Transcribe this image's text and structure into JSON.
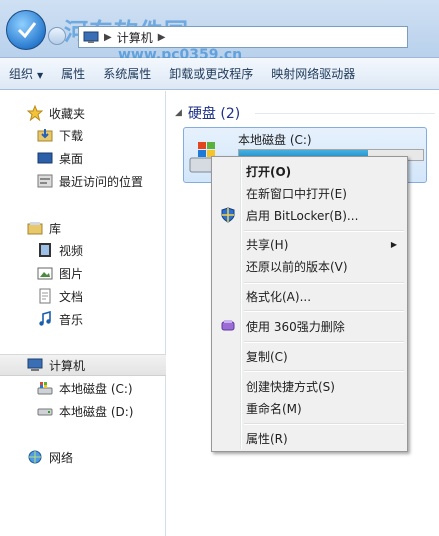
{
  "window": {
    "address_crumb": "计算机",
    "watermark": "河东软件园",
    "watermark_url": "www.pc0359.cn"
  },
  "toolbar": {
    "organize": "组织",
    "properties": "属性",
    "system_properties": "系统属性",
    "uninstall": "卸载或更改程序",
    "map_drive": "映射网络驱动器"
  },
  "sidebar": {
    "favorites": "收藏夹",
    "downloads": "下载",
    "desktop": "桌面",
    "recent": "最近访问的位置",
    "libraries": "库",
    "videos": "视频",
    "pictures": "图片",
    "documents": "文档",
    "music": "音乐",
    "computer": "计算机",
    "drive_c": "本地磁盘 (C:)",
    "drive_d": "本地磁盘 (D:)",
    "network": "网络"
  },
  "content": {
    "group_title": "硬盘 (2)",
    "drive_label": "本地磁盘 (C:)",
    "drive_usage": 0.7
  },
  "context_menu": {
    "open": "打开(O)",
    "open_new_window": "在新窗口中打开(E)",
    "bitlocker": "启用 BitLocker(B)...",
    "share": "共享(H)",
    "restore": "还原以前的版本(V)",
    "format": "格式化(A)...",
    "delete_360": "使用 360强力删除",
    "copy": "复制(C)",
    "create_shortcut": "创建快捷方式(S)",
    "rename": "重命名(M)",
    "properties": "属性(R)"
  }
}
